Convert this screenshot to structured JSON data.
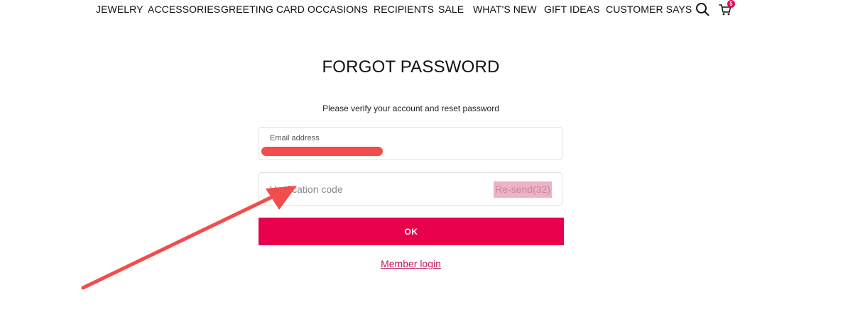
{
  "nav": {
    "items": [
      {
        "label": "JEWELRY"
      },
      {
        "label": "ACCESSORIES"
      },
      {
        "label": "GREETING CARD"
      },
      {
        "label": "OCCASIONS"
      },
      {
        "label": "RECIPIENTS"
      },
      {
        "label": "SALE"
      },
      {
        "label": "WHAT'S NEW"
      },
      {
        "label": "GIFT IDEAS"
      },
      {
        "label": "CUSTOMER SAYS"
      }
    ],
    "search_icon": "search-icon",
    "cart_icon": "cart-icon",
    "cart_count": "5"
  },
  "page": {
    "title": "FORGOT PASSWORD",
    "subtitle": "Please verify your account and reset password"
  },
  "form": {
    "email_label": "Email address",
    "code_placeholder": "Verification code",
    "resend_label": "Re-send(32)",
    "ok_label": "OK",
    "member_login_label": "Member login"
  },
  "colors": {
    "accent": "#e8004d",
    "annotation": "#f24c4c",
    "link": "#c2185b"
  }
}
